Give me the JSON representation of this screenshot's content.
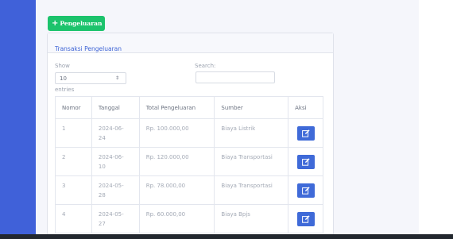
{
  "add_button": {
    "icon": "plus-icon",
    "label": "Pengeluaran"
  },
  "card": {
    "title": "Transaksi Pengeluaran"
  },
  "length_control": {
    "show": "Show",
    "value": "10",
    "entries": "entries"
  },
  "search": {
    "label": "Search:",
    "value": ""
  },
  "table": {
    "headers": [
      "Nomor",
      "Tanggal",
      "Total Pengeluaran",
      "Sumber",
      "Aksi"
    ],
    "rows": [
      {
        "nomor": "1",
        "tanggal_1": "2024-06-",
        "tanggal_2": "24",
        "total": "Rp. 100.000,00",
        "sumber": "Biaya Listrik",
        "aksi_icon": "edit-icon"
      },
      {
        "nomor": "2",
        "tanggal_1": "2024-06-",
        "tanggal_2": "10",
        "total": "Rp. 120.000,00",
        "sumber": "Biaya Transportasi",
        "aksi_icon": "edit-icon"
      },
      {
        "nomor": "3",
        "tanggal_1": "2024-05-",
        "tanggal_2": "28",
        "total": "Rp. 78.000,00",
        "sumber": "Biaya Transportasi",
        "aksi_icon": "edit-icon"
      },
      {
        "nomor": "4",
        "tanggal_1": "2024-05-",
        "tanggal_2": "27",
        "total": "Rp. 60.000,00",
        "sumber": "Biaya Bpjs",
        "aksi_icon": "edit-icon"
      }
    ]
  },
  "colors": {
    "sidebar": "#4061d9",
    "add_button": "#1cc36c",
    "primary": "#3f6ad8",
    "title": "#3d63d5"
  }
}
